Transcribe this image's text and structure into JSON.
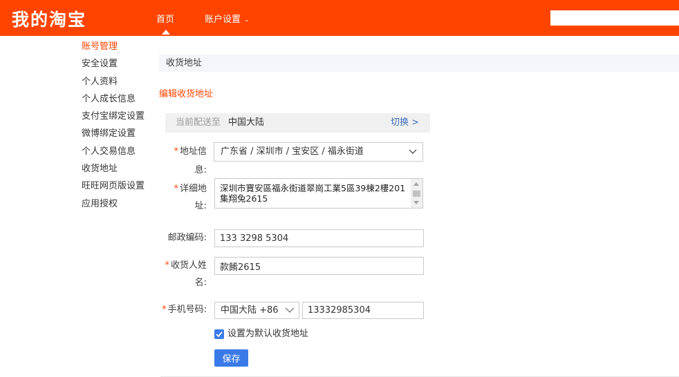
{
  "header": {
    "logo": "我的淘宝",
    "nav": [
      {
        "label": "首页"
      },
      {
        "label": "账户设置"
      }
    ],
    "account_chevron": "⌄"
  },
  "sidebar": {
    "items": [
      {
        "label": "账号管理"
      },
      {
        "label": "安全设置"
      },
      {
        "label": "个人资料"
      },
      {
        "label": "个人成长信息"
      },
      {
        "label": "支付宝绑定设置"
      },
      {
        "label": "微博绑定设置"
      },
      {
        "label": "个人交易信息"
      },
      {
        "label": "收货地址"
      },
      {
        "label": "旺旺网页版设置"
      },
      {
        "label": "应用授权"
      }
    ]
  },
  "main": {
    "section_title": "收货地址",
    "edit_title": "编辑收货地址",
    "deliver": {
      "label": "当前配送至",
      "value": "中国大陆",
      "switch": "切换 >"
    },
    "form": {
      "required_mark": "*",
      "region_label_1": "地址信",
      "region_label_2": "息:",
      "region_value": "广东省 / 深圳市 / 宝安区 / 福永街道",
      "detail_label_1": "详细地",
      "detail_label_2": "址:",
      "detail_value": "深圳市寶安區福永街道翠崗工業5區39棟2樓201集翔兔2615",
      "postcode_label": "邮政编码:",
      "postcode_value": "133 3298 5304",
      "name_label_1": "收货人姓",
      "name_label_2": "名:",
      "name_value": "款餚2615",
      "phone_label": "手机号码:",
      "phone_region": "中国大陆 +86",
      "phone_value": "13332985304",
      "default_checkbox_label": "设置为默认收货地址",
      "default_checked": true,
      "save_label": "保存"
    }
  },
  "colors": {
    "brand": "#ff4400",
    "primary_button": "#3a7ae8",
    "link": "#3a6fbd"
  }
}
